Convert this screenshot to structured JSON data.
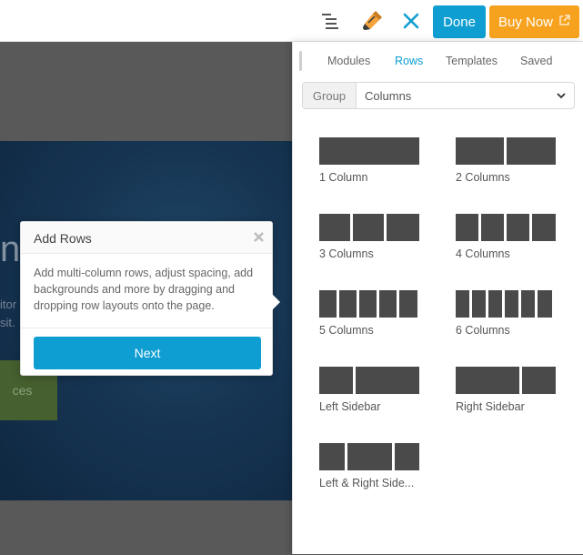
{
  "toolbar": {
    "outline_icon": "outline-list-icon",
    "pen_icon": "pen-icon",
    "close_icon": "close-icon",
    "done_label": "Done",
    "buy_label": "Buy Now",
    "buy_icon": "external-link-icon",
    "colors": {
      "done": "#0e9ed2",
      "buy": "#f6a21e",
      "close": "#0e9ed2"
    }
  },
  "background": {
    "hero_heading": "n",
    "hero_line1": "itor",
    "hero_line2": "sit.",
    "hero_button": "ces"
  },
  "tooltip": {
    "title": "Add Rows",
    "body": "Add multi-column rows, adjust spacing, add backgrounds and more by dragging and dropping row layouts onto the page.",
    "next_label": "Next"
  },
  "panel": {
    "tabs": [
      {
        "label": "Modules",
        "active": false
      },
      {
        "label": "Rows",
        "active": true
      },
      {
        "label": "Templates",
        "active": false
      },
      {
        "label": "Saved",
        "active": false
      }
    ],
    "group": {
      "label": "Group",
      "value": "Columns"
    },
    "layouts": [
      {
        "label": "1 Column"
      },
      {
        "label": "2 Columns"
      },
      {
        "label": "3 Columns"
      },
      {
        "label": "4 Columns"
      },
      {
        "label": "5 Columns"
      },
      {
        "label": "6 Columns"
      },
      {
        "label": "Left Sidebar"
      },
      {
        "label": "Right Sidebar"
      },
      {
        "label": "Left & Right Side..."
      }
    ]
  }
}
